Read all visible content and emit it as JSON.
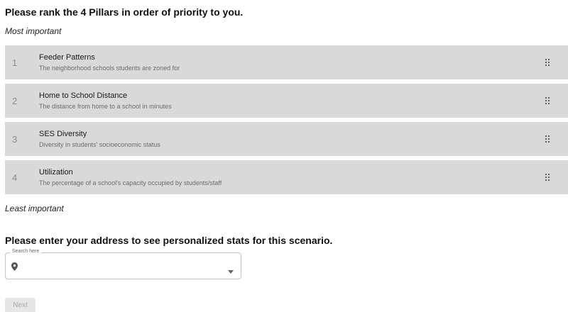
{
  "ranking": {
    "heading": "Please rank the 4 Pillars in order of priority to you.",
    "most_label": "Most important",
    "least_label": "Least important",
    "items": [
      {
        "rank": "1",
        "title": "Feeder Patterns",
        "description": "The neighborhood schools students are zoned for"
      },
      {
        "rank": "2",
        "title": "Home to School Distance",
        "description": "The distance from home to a school in minutes"
      },
      {
        "rank": "3",
        "title": "SES Diversity",
        "description": "Diversity in students' socioeconomic status"
      },
      {
        "rank": "4",
        "title": "Utilization",
        "description": "The percentage of a school's capacity occupied by students/staff"
      }
    ]
  },
  "address": {
    "heading": "Please enter your address to see personalized stats for this scenario.",
    "field_label": "Search here",
    "value": ""
  },
  "actions": {
    "next_label": "Next"
  },
  "colors": {
    "item_background": "#d9d9d9",
    "button_disabled_background": "#e6e6e6",
    "button_disabled_text": "#a9a9a9"
  }
}
